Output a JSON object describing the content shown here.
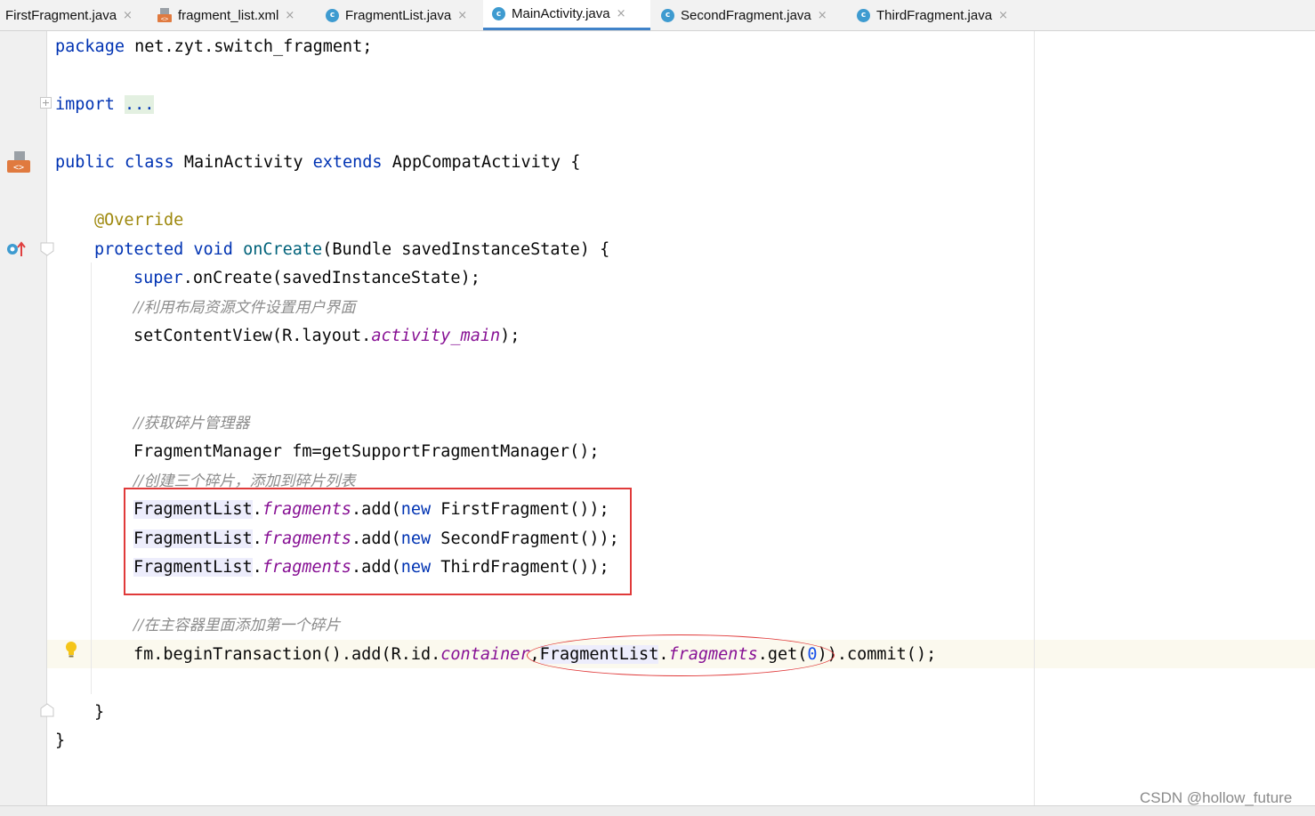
{
  "tabs": [
    {
      "label": "FirstFragment.java",
      "icon": "none",
      "active": false
    },
    {
      "label": "fragment_list.xml",
      "icon": "xml-file-icon",
      "active": false
    },
    {
      "label": "FragmentList.java",
      "icon": "class-icon",
      "active": false
    },
    {
      "label": "MainActivity.java",
      "icon": "class-icon",
      "active": true
    },
    {
      "label": "SecondFragment.java",
      "icon": "class-icon",
      "active": false
    },
    {
      "label": "ThirdFragment.java",
      "icon": "class-icon",
      "active": false
    }
  ],
  "close_glyph": "×",
  "class_icon_letter": "c",
  "code": {
    "l1_kw": "package",
    "l1_rest": " net.zyt.switch_fragment;",
    "l2_kw": "import",
    "l2_fold": "...",
    "l3_kw1": "public",
    "l3_kw2": "class",
    "l3_name": "MainActivity",
    "l3_kw3": "extends",
    "l3_rest": "AppCompatActivity {",
    "l4_ann": "@Override",
    "l5_kw1": "protected",
    "l5_kw2": "void",
    "l5_fn": "onCreate",
    "l5_rest": "(Bundle savedInstanceState) {",
    "l6_kw": "super",
    "l6_rest": ".onCreate(savedInstanceState);",
    "l7_cmt": "//利用布局资源文件设置用户界面",
    "l8_a": "setContentView(R.layout.",
    "l8_fld": "activity_main",
    "l8_b": ");",
    "l9_cmt": "//获取碎片管理器",
    "l10": "FragmentManager fm=getSupportFragmentManager();",
    "l11_cmt": "//创建三个碎片，添加到碎片列表",
    "l12_cls": "FragmentList",
    "l12_dot": ".",
    "l12_fld": "fragments",
    "l12_mid": ".add(",
    "l12_kw": "new",
    "l12_end": " FirstFragment());",
    "l13_end": " SecondFragment());",
    "l14_end": " ThirdFragment());",
    "l15_cmt": "//在主容器里面添加第一个碎片",
    "l16_a": "fm.beginTransaction().add(R.id.",
    "l16_fld1": "container",
    "l16_comma": ",",
    "l16_cls": "FragmentList",
    "l16_dot": ".",
    "l16_fld2": "fragments",
    "l16_get": ".get(",
    "l16_num": "0",
    "l16_end": ")).commit();",
    "l17": "}",
    "l18": "}"
  },
  "watermark": "CSDN @hollow_future",
  "colors": {
    "keyword": "#0033b3",
    "annotation": "#9e880d",
    "method": "#00627a",
    "field": "#871094",
    "comment": "#8c8c8c",
    "number": "#1750eb",
    "highlight_box": "#e03a3a",
    "active_tab_underline": "#4083c9"
  }
}
